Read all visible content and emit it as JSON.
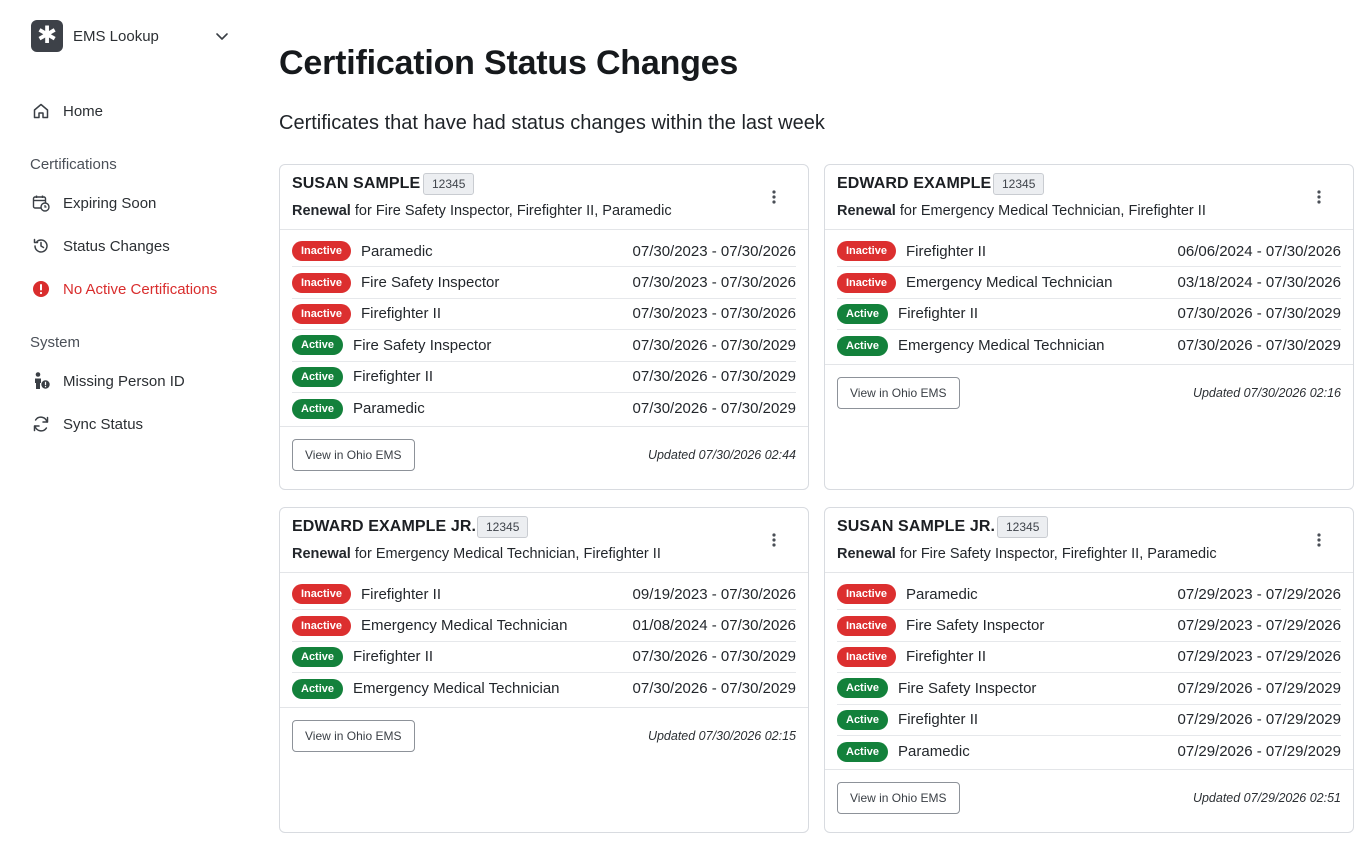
{
  "app": {
    "name": "EMS Lookup",
    "logo_glyph": "✱"
  },
  "nav": {
    "home": "Home",
    "section_certifications": "Certifications",
    "expiring_soon": "Expiring Soon",
    "status_changes": "Status Changes",
    "no_active": "No Active Certifications",
    "section_system": "System",
    "missing_person_id": "Missing Person ID",
    "sync_status": "Sync Status"
  },
  "page": {
    "title": "Certification Status Changes",
    "subtitle": "Certificates that have had status changes within the last week"
  },
  "colors": {
    "inactive": "#dc2f2f",
    "active": "#13813b",
    "danger": "#d92d2d"
  },
  "cards": [
    {
      "name": "SUSAN SAMPLE",
      "id": "12345",
      "type": "Renewal",
      "summary": " for Fire Safety Inspector, Firefighter II, Paramedic",
      "rows": [
        {
          "status": "Inactive",
          "cert": "Paramedic",
          "dates": "07/30/2023 - 07/30/2026"
        },
        {
          "status": "Inactive",
          "cert": "Fire Safety Inspector",
          "dates": "07/30/2023 - 07/30/2026"
        },
        {
          "status": "Inactive",
          "cert": "Firefighter II",
          "dates": "07/30/2023 - 07/30/2026"
        },
        {
          "status": "Active",
          "cert": "Fire Safety Inspector",
          "dates": "07/30/2026 - 07/30/2029"
        },
        {
          "status": "Active",
          "cert": "Firefighter II",
          "dates": "07/30/2026 - 07/30/2029"
        },
        {
          "status": "Active",
          "cert": "Paramedic",
          "dates": "07/30/2026 - 07/30/2029"
        }
      ],
      "button": "View in Ohio EMS",
      "updated": "Updated 07/30/2026 02:44"
    },
    {
      "name": "EDWARD EXAMPLE",
      "id": "12345",
      "type": "Renewal",
      "summary": " for Emergency Medical Technician, Firefighter II",
      "rows": [
        {
          "status": "Inactive",
          "cert": "Firefighter II",
          "dates": "06/06/2024 - 07/30/2026"
        },
        {
          "status": "Inactive",
          "cert": "Emergency Medical Technician",
          "dates": "03/18/2024 - 07/30/2026"
        },
        {
          "status": "Active",
          "cert": "Firefighter II",
          "dates": "07/30/2026 - 07/30/2029"
        },
        {
          "status": "Active",
          "cert": "Emergency Medical Technician",
          "dates": "07/30/2026 - 07/30/2029"
        }
      ],
      "button": "View in Ohio EMS",
      "updated": "Updated 07/30/2026 02:16"
    },
    {
      "name": "EDWARD EXAMPLE JR.",
      "id": "12345",
      "type": "Renewal",
      "summary": " for Emergency Medical Technician, Firefighter II",
      "rows": [
        {
          "status": "Inactive",
          "cert": "Firefighter II",
          "dates": "09/19/2023 - 07/30/2026"
        },
        {
          "status": "Inactive",
          "cert": "Emergency Medical Technician",
          "dates": "01/08/2024 - 07/30/2026"
        },
        {
          "status": "Active",
          "cert": "Firefighter II",
          "dates": "07/30/2026 - 07/30/2029"
        },
        {
          "status": "Active",
          "cert": "Emergency Medical Technician",
          "dates": "07/30/2026 - 07/30/2029"
        }
      ],
      "button": "View in Ohio EMS",
      "updated": "Updated 07/30/2026 02:15"
    },
    {
      "name": "SUSAN SAMPLE JR.",
      "id": "12345",
      "type": "Renewal",
      "summary": " for Fire Safety Inspector, Firefighter II, Paramedic",
      "rows": [
        {
          "status": "Inactive",
          "cert": "Paramedic",
          "dates": "07/29/2023 - 07/29/2026"
        },
        {
          "status": "Inactive",
          "cert": "Fire Safety Inspector",
          "dates": "07/29/2023 - 07/29/2026"
        },
        {
          "status": "Inactive",
          "cert": "Firefighter II",
          "dates": "07/29/2023 - 07/29/2026"
        },
        {
          "status": "Active",
          "cert": "Fire Safety Inspector",
          "dates": "07/29/2026 - 07/29/2029"
        },
        {
          "status": "Active",
          "cert": "Firefighter II",
          "dates": "07/29/2026 - 07/29/2029"
        },
        {
          "status": "Active",
          "cert": "Paramedic",
          "dates": "07/29/2026 - 07/29/2029"
        }
      ],
      "button": "View in Ohio EMS",
      "updated": "Updated 07/29/2026 02:51"
    }
  ]
}
